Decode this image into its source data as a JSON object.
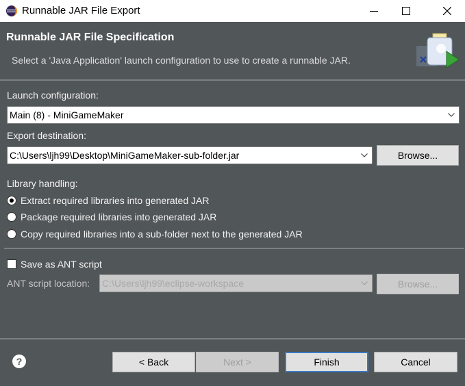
{
  "window": {
    "title": "Runnable JAR File Export",
    "minimize_icon": "minimize-icon",
    "maximize_icon": "maximize-icon",
    "close_icon": "close-icon"
  },
  "header": {
    "title": "Runnable JAR File Specification",
    "description": "Select a 'Java Application' launch configuration to use to create a runnable JAR."
  },
  "launch": {
    "label": "Launch configuration:",
    "value": "Main (8) - MiniGameMaker"
  },
  "export": {
    "label": "Export destination:",
    "value": "C:\\Users\\ljh99\\Desktop\\MiniGameMaker-sub-folder.jar",
    "browse": "Browse..."
  },
  "library": {
    "label": "Library handling:",
    "options": [
      {
        "label": "Extract required libraries into generated JAR",
        "checked": true
      },
      {
        "label": "Package required libraries into generated JAR",
        "checked": false
      },
      {
        "label": "Copy required libraries into a sub-folder next to the generated JAR",
        "checked": false
      }
    ]
  },
  "ant": {
    "checkbox_label": "Save as ANT script",
    "checked": false,
    "location_label": "ANT script location:",
    "location_value": "C:\\Users\\ljh99\\eclipse-workspace",
    "browse": "Browse..."
  },
  "footer": {
    "help_icon": "help-icon",
    "back": "< Back",
    "next": "Next >",
    "finish": "Finish",
    "cancel": "Cancel"
  }
}
